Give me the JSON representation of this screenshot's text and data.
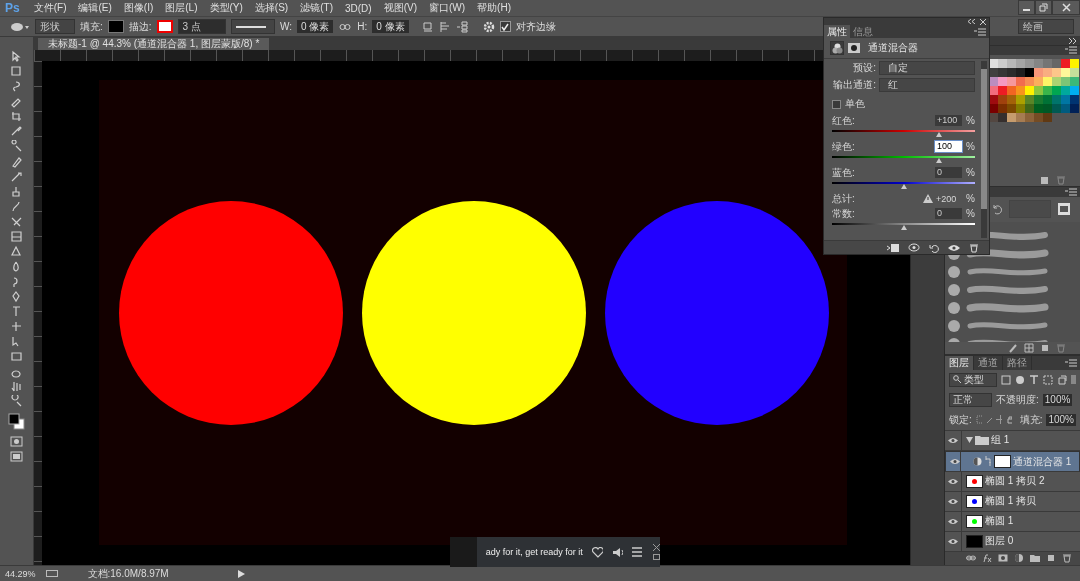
{
  "app_logo": "Ps",
  "menu": [
    "文件(F)",
    "编辑(E)",
    "图像(I)",
    "图层(L)",
    "类型(Y)",
    "选择(S)",
    "滤镜(T)",
    "3D(D)",
    "视图(V)",
    "窗口(W)",
    "帮助(H)"
  ],
  "options_bar": {
    "shape_mode": "形状",
    "fill_label": "填充:",
    "stroke_label": "描边:",
    "stroke_width": "3 点",
    "w_label": "W:",
    "w_value": "0 像素",
    "h_label": "H:",
    "h_value": "0 像素",
    "align_edges": {
      "label": "对齐边缘",
      "checked": true
    },
    "workspace": "绘画"
  },
  "document_tab": {
    "title": "未标题-1 @ 44.3% (通道混合器 1, 图层蒙版/8) *"
  },
  "canvas": {
    "shapes": [
      {
        "color": "#ff0000"
      },
      {
        "color": "#ffff00"
      },
      {
        "color": "#2200ff"
      }
    ]
  },
  "properties_panel": {
    "tabs": [
      {
        "label": "属性",
        "selected": true
      },
      {
        "label": "信息",
        "selected": false
      }
    ],
    "title": "通道混合器",
    "preset": {
      "label": "预设:",
      "value": "自定"
    },
    "output_channel": {
      "label": "输出通道:",
      "value": "红"
    },
    "monochrome": {
      "label": "单色",
      "checked": false
    },
    "rows": [
      {
        "kind": "slider",
        "label": "红色:",
        "value": "+100",
        "unit": "%",
        "level": 0.75,
        "editing": false
      },
      {
        "kind": "slider",
        "label": "绿色:",
        "value": "100",
        "unit": "%",
        "level": 0.75,
        "editing": true
      },
      {
        "kind": "slider",
        "label": "蓝色:",
        "value": "0",
        "unit": "%",
        "level": 0.5,
        "editing": false
      },
      {
        "kind": "total",
        "label": "总计:",
        "value": "+200",
        "unit": "%"
      },
      {
        "kind": "slider",
        "label": "常数:",
        "value": "0",
        "unit": "%",
        "level": 0.5,
        "editing": false
      }
    ]
  },
  "swatches": [
    {
      "color": "#e0e0e0"
    },
    {
      "color": "#cccccc"
    },
    {
      "color": "#b8b8b8"
    },
    {
      "color": "#a5a5a5"
    },
    {
      "color": "#959595"
    },
    {
      "color": "#858585"
    },
    {
      "color": "#757575"
    },
    {
      "color": "#666666"
    },
    {
      "color": "#ed1c24"
    },
    {
      "color": "#fff200"
    },
    {
      "color": "#404040"
    },
    {
      "color": "#363636"
    },
    {
      "color": "#2c2c2c"
    },
    {
      "color": "#1f1f1f"
    },
    {
      "color": "#000000"
    },
    {
      "color": "#f7977a"
    },
    {
      "color": "#f9ad81"
    },
    {
      "color": "#fdc68a"
    },
    {
      "color": "#fff79a"
    },
    {
      "color": "#c4df9b"
    },
    {
      "color": "#bc8dbf"
    },
    {
      "color": "#f49ac2"
    },
    {
      "color": "#f6989d"
    },
    {
      "color": "#f26c4f"
    },
    {
      "color": "#f68e55"
    },
    {
      "color": "#fbaf5c"
    },
    {
      "color": "#fff467"
    },
    {
      "color": "#acd372"
    },
    {
      "color": "#7cc576"
    },
    {
      "color": "#3bb878"
    },
    {
      "color": "#f26d7d"
    },
    {
      "color": "#ed1c24"
    },
    {
      "color": "#f26522"
    },
    {
      "color": "#f7941d"
    },
    {
      "color": "#fff200"
    },
    {
      "color": "#8dc63f"
    },
    {
      "color": "#39b54a"
    },
    {
      "color": "#00a651"
    },
    {
      "color": "#00a99d"
    },
    {
      "color": "#00aeef"
    },
    {
      "color": "#9e0b0f"
    },
    {
      "color": "#a0410d"
    },
    {
      "color": "#a36209"
    },
    {
      "color": "#aba000"
    },
    {
      "color": "#598527"
    },
    {
      "color": "#1a7b30"
    },
    {
      "color": "#007236"
    },
    {
      "color": "#00746b"
    },
    {
      "color": "#0076a3"
    },
    {
      "color": "#003471"
    },
    {
      "color": "#790000"
    },
    {
      "color": "#7b2e00"
    },
    {
      "color": "#7d4900"
    },
    {
      "color": "#827b00"
    },
    {
      "color": "#406618"
    },
    {
      "color": "#005e20"
    },
    {
      "color": "#005826"
    },
    {
      "color": "#005952"
    },
    {
      "color": "#005b7f"
    },
    {
      "color": "#002157"
    },
    {
      "color": "#534741"
    },
    {
      "color": "#362f2d"
    },
    {
      "color": "#c69c6d"
    },
    {
      "color": "#a67c52"
    },
    {
      "color": "#8c6239"
    },
    {
      "color": "#754c24"
    },
    {
      "color": "#603913"
    }
  ],
  "layers_panel": {
    "tabs": [
      {
        "label": "图层",
        "selected": true
      },
      {
        "label": "通道",
        "selected": false
      },
      {
        "label": "路径",
        "selected": false
      }
    ],
    "filter": "类型",
    "blend_mode": "正常",
    "opacity_label": "不透明度:",
    "opacity": "100%",
    "lock_label": "锁定:",
    "fill_label": "填充:",
    "fill": "100%",
    "layers": [
      {
        "kind": "group",
        "name": "组 1",
        "visible": true,
        "selected": false,
        "expanded": true,
        "children": [
          {
            "kind": "adjustment",
            "name": "通道混合器 1",
            "visible": true,
            "selected": true
          }
        ]
      },
      {
        "kind": "shape",
        "name": "椭圆 1 拷贝 2",
        "visible": true,
        "selected": false,
        "color": "#ff0000"
      },
      {
        "kind": "shape",
        "name": "椭圆 1 拷贝",
        "visible": true,
        "selected": false,
        "color": "#0000ff"
      },
      {
        "kind": "shape",
        "name": "椭圆 1",
        "visible": true,
        "selected": false,
        "color": "#00ff00"
      },
      {
        "kind": "pixel",
        "name": "图层 0",
        "visible": true,
        "selected": false
      }
    ]
  },
  "status_bar": {
    "zoom": "44.29%",
    "doc_info": "文档:16.0M/8.97M"
  },
  "media_player": {
    "text": "ady for it, get ready for it"
  }
}
